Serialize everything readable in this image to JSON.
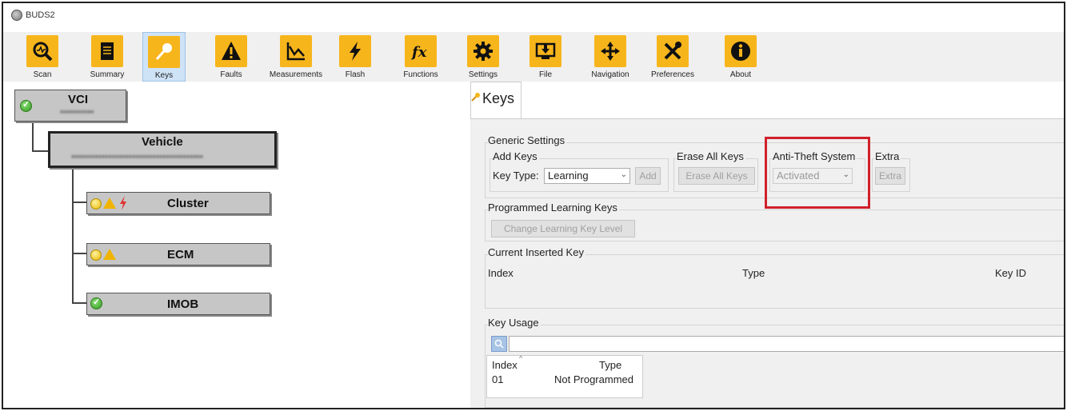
{
  "app": {
    "title": "BUDS2"
  },
  "toolbar": {
    "items": [
      {
        "label": "Scan",
        "icon": "scan-icon"
      },
      {
        "label": "Summary",
        "icon": "summary-icon"
      },
      {
        "label": "Keys",
        "icon": "key-icon",
        "active": true
      },
      {
        "label": "Faults",
        "icon": "faults-icon"
      },
      {
        "label": "Measurements",
        "icon": "measurements-icon"
      },
      {
        "label": "Flash",
        "icon": "flash-icon"
      },
      {
        "label": "Functions",
        "icon": "functions-icon"
      },
      {
        "label": "Settings",
        "icon": "gear-icon"
      },
      {
        "label": "File",
        "icon": "file-icon"
      },
      {
        "label": "Navigation",
        "icon": "navigation-icon"
      },
      {
        "label": "Preferences",
        "icon": "preferences-icon"
      },
      {
        "label": "About",
        "icon": "info-icon"
      }
    ]
  },
  "tree": {
    "vci": {
      "name": "VCI"
    },
    "vehicle": {
      "name": "Vehicle"
    },
    "modules": [
      {
        "name": "Cluster",
        "status": "warning-fault"
      },
      {
        "name": "ECM",
        "status": "warning"
      },
      {
        "name": "IMOB",
        "status": "ok"
      }
    ]
  },
  "keys": {
    "title": "Keys",
    "generic": {
      "legend": "Generic Settings",
      "add_keys": {
        "legend": "Add Keys",
        "key_type_label": "Key Type:",
        "key_type_value": "Learning",
        "add_button": "Add"
      },
      "erase_all": {
        "legend": "Erase All Keys",
        "button": "Erase All Keys"
      },
      "anti_theft": {
        "legend": "Anti-Theft System",
        "value": "Activated"
      },
      "extra": {
        "legend": "Extra",
        "button": "Extra"
      }
    },
    "programmed": {
      "legend": "Programmed Learning Keys",
      "button": "Change Learning Key Level"
    },
    "current": {
      "legend": "Current Inserted Key",
      "col_index": "Index",
      "col_type": "Type",
      "col_key_id": "Key ID"
    },
    "usage": {
      "legend": "Key Usage",
      "col_index": "Index",
      "col_type": "Type",
      "rows": [
        {
          "index": "01",
          "type": "Not Programmed"
        }
      ]
    }
  },
  "colors": {
    "accent": "#f7b51c",
    "highlight": "#d0202a",
    "active_tab": "#cfe3f7"
  }
}
